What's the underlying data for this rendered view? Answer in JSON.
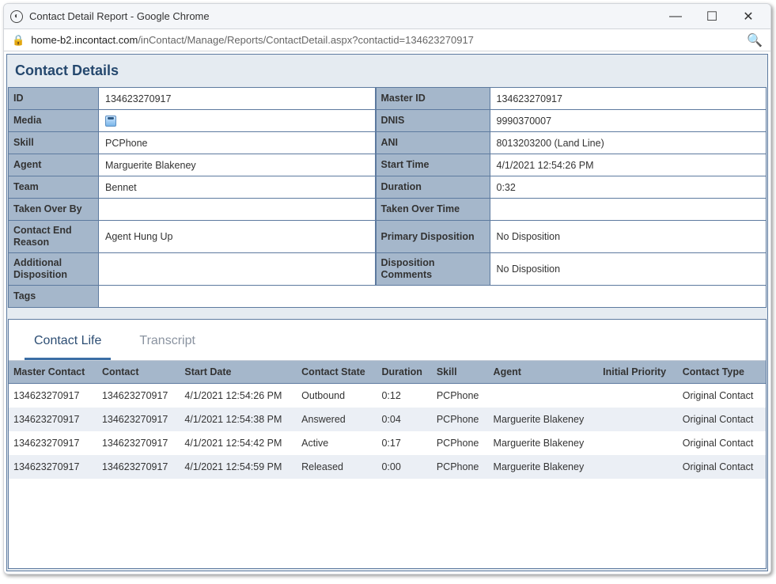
{
  "window": {
    "title": "Contact Detail Report - Google Chrome",
    "url_host": "home-b2.incontact.com",
    "url_path": "/inContact/Manage/Reports/ContactDetail.aspx?contactid=134623270917"
  },
  "heading": "Contact Details",
  "details": {
    "labels": {
      "id": "ID",
      "master_id": "Master ID",
      "media": "Media",
      "dnis": "DNIS",
      "skill": "Skill",
      "ani": "ANI",
      "agent": "Agent",
      "start_time": "Start Time",
      "team": "Team",
      "duration": "Duration",
      "taken_by": "Taken Over By",
      "taken_time": "Taken Over Time",
      "end_reason": "Contact End Reason",
      "prim_disp": "Primary Disposition",
      "add_disp": "Additional Disposition",
      "disp_comments": "Disposition Comments",
      "tags": "Tags"
    },
    "values": {
      "id": "134623270917",
      "master_id": "134623270917",
      "media": "",
      "dnis": "9990370007",
      "skill": "PCPhone",
      "ani": "8013203200 (Land Line)",
      "agent": "Marguerite Blakeney",
      "start_time": "4/1/2021 12:54:26 PM",
      "team": "Bennet",
      "duration": "0:32",
      "taken_by": "",
      "taken_time": "",
      "end_reason": "Agent Hung Up",
      "prim_disp": "No Disposition",
      "add_disp": "",
      "disp_comments": "No Disposition",
      "tags": ""
    }
  },
  "tabs": {
    "contact_life": "Contact Life",
    "transcript": "Transcript"
  },
  "columns": {
    "master_contact": "Master Contact",
    "contact": "Contact",
    "start_date": "Start Date",
    "state": "Contact State",
    "duration": "Duration",
    "skill": "Skill",
    "agent": "Agent",
    "init_priority": "Initial Priority",
    "contact_type": "Contact Type"
  },
  "rows": [
    {
      "master": "134623270917",
      "contact": "134623270917",
      "start": "4/1/2021 12:54:26 PM",
      "state": "Outbound",
      "dur": "0:12",
      "skill": "PCPhone",
      "agent": "",
      "prio": "",
      "type": "Original Contact"
    },
    {
      "master": "134623270917",
      "contact": "134623270917",
      "start": "4/1/2021 12:54:38 PM",
      "state": "Answered",
      "dur": "0:04",
      "skill": "PCPhone",
      "agent": "Marguerite Blakeney",
      "prio": "",
      "type": "Original Contact"
    },
    {
      "master": "134623270917",
      "contact": "134623270917",
      "start": "4/1/2021 12:54:42 PM",
      "state": "Active",
      "dur": "0:17",
      "skill": "PCPhone",
      "agent": "Marguerite Blakeney",
      "prio": "",
      "type": "Original Contact"
    },
    {
      "master": "134623270917",
      "contact": "134623270917",
      "start": "4/1/2021 12:54:59 PM",
      "state": "Released",
      "dur": "0:00",
      "skill": "PCPhone",
      "agent": "Marguerite Blakeney",
      "prio": "",
      "type": "Original Contact"
    }
  ]
}
